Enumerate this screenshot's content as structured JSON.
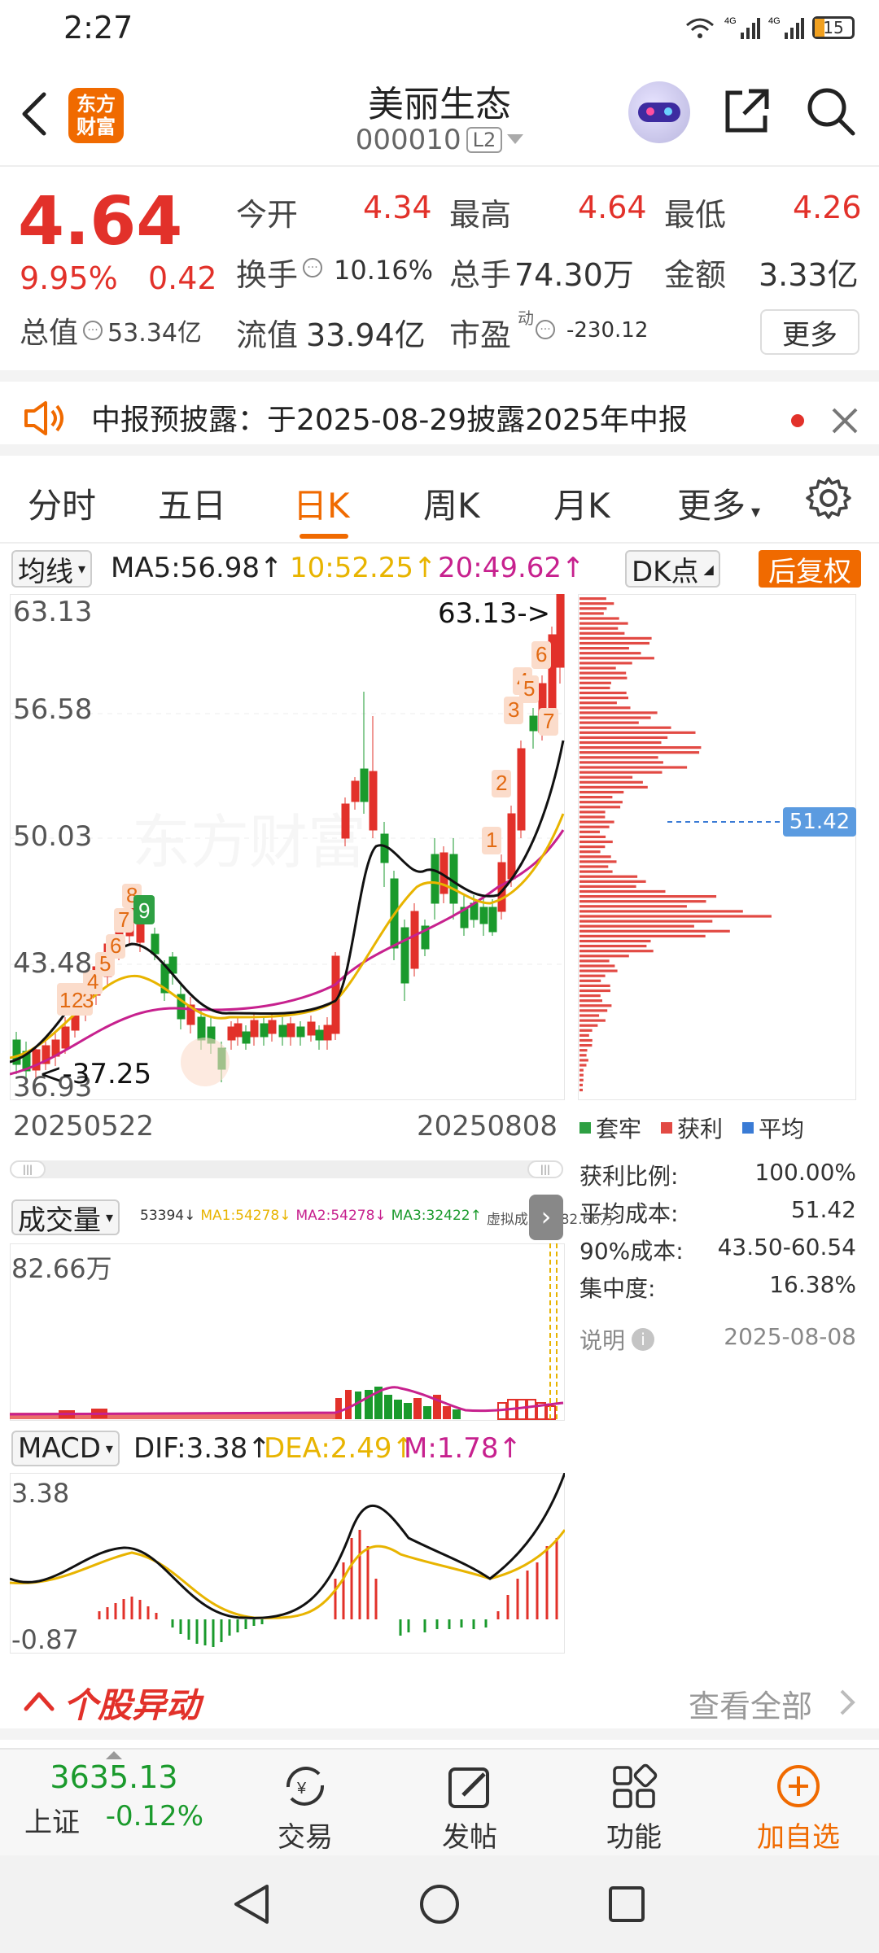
{
  "status": {
    "time": "2:27",
    "battery": "15",
    "network": [
      "4G",
      "4G"
    ]
  },
  "header": {
    "logo_text": [
      "东方",
      "财富"
    ],
    "title": "美丽生态",
    "code": "000010",
    "level_badge": "L2"
  },
  "quote": {
    "price": "4.64",
    "change_pct": "9.95%",
    "change_abs": "0.42",
    "open_label": "今开",
    "open": "4.34",
    "high_label": "最高",
    "high": "4.64",
    "low_label": "最低",
    "low": "4.26",
    "turnover_label": "换手",
    "turnover": "10.16%",
    "volume_label": "总手",
    "volume": "74.30万",
    "amount_label": "金额",
    "amount": "3.33亿",
    "mktcap_label": "总值",
    "mktcap": "53.34亿",
    "float_label": "流值",
    "float_cap": "33.94亿",
    "pe_label": "市盈",
    "pe_sup": "动",
    "pe": "-230.12",
    "more_label": "更多"
  },
  "notice": {
    "text": "中报预披露：于2025-08-29披露2025年中报"
  },
  "tabs": [
    "分时",
    "五日",
    "日K",
    "周K",
    "月K",
    "更多"
  ],
  "active_tab": "日K",
  "kline": {
    "ma_select": "均线",
    "ma5": "MA5:56.98↑",
    "ma10": "10:52.25↑",
    "ma20": "20:49.62↑",
    "dk_select": "DK点",
    "restore": "后复权",
    "y_ticks": [
      "63.13",
      "56.58",
      "50.03",
      "43.48",
      "36.93"
    ],
    "high_marker": "63.13->",
    "low_marker": "<-37.25",
    "date_start": "20250522",
    "date_end": "20250808",
    "avg_cost_tag": "51.42",
    "buy_markers": [
      "1",
      "2",
      "3",
      "4",
      "5",
      "6",
      "7",
      "8",
      "9"
    ]
  },
  "cost_dist": {
    "legend": [
      "套牢",
      "获利",
      "平均"
    ],
    "rows": [
      {
        "label": "获利比例:",
        "value": "100.00%"
      },
      {
        "label": "平均成本:",
        "value": "51.42"
      },
      {
        "label": "90%成本:",
        "value": "43.50-60.54"
      },
      {
        "label": "集中度:",
        "value": "16.38%"
      }
    ],
    "note_label": "说明",
    "date": "2025-08-08"
  },
  "volume": {
    "select": "成交量",
    "legend": [
      "53394↓",
      "MA1:54278↓",
      "MA2:54278↓",
      "MA3:32422↑",
      "虚拟成交量:82.66万"
    ],
    "max_label": "82.66万"
  },
  "macd": {
    "select": "MACD",
    "dif": "DIF:3.38↑",
    "dea": "DEA:2.49↑",
    "m": "M:1.78↑",
    "top": "3.38",
    "bottom": "-0.87"
  },
  "movers": {
    "title": "个股异动",
    "view_all": "查看全部"
  },
  "bottom_nav": {
    "index_value": "3635.13",
    "index_name": "上证",
    "index_change": "-0.12%",
    "items": [
      "交易",
      "发帖",
      "功能",
      "加自选"
    ]
  },
  "colors": {
    "up": "#e2312a",
    "down": "#1a9a2c",
    "accent": "#f06a00",
    "ma10": "#e8b400",
    "ma20": "#c7218e"
  }
}
